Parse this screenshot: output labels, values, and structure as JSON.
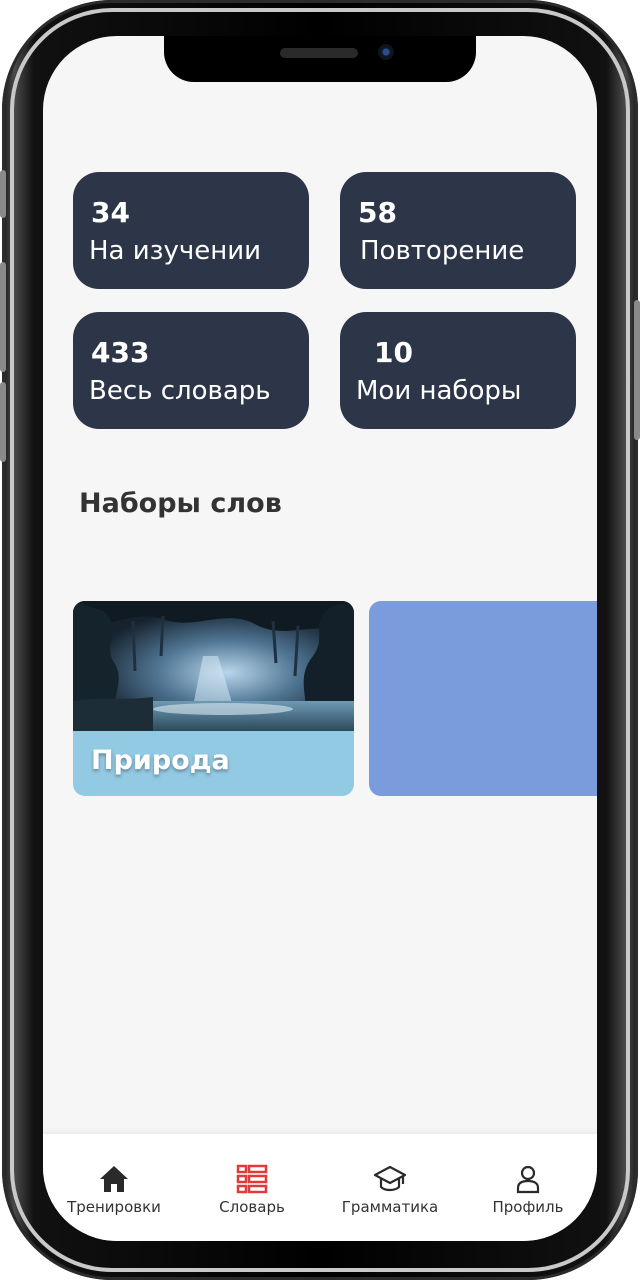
{
  "stats": [
    {
      "value": "34",
      "label": "На изучении"
    },
    {
      "value": "58",
      "label": "Повторение"
    },
    {
      "value": "433",
      "label": "Весь словарь"
    },
    {
      "value": "10",
      "label": "Мои наборы"
    }
  ],
  "sets_section": {
    "title": "Наборы слов"
  },
  "sets": [
    {
      "label": "Природа",
      "color": "#92c9e3"
    },
    {
      "label": "",
      "color": "#7b9cdc"
    }
  ],
  "tabbar": {
    "items": [
      {
        "label": "Тренировки",
        "icon": "home-icon"
      },
      {
        "label": "Словарь",
        "icon": "list-icon",
        "active": true
      },
      {
        "label": "Грамматика",
        "icon": "graduation-cap-icon"
      },
      {
        "label": "Профиль",
        "icon": "user-icon"
      }
    ]
  },
  "colors": {
    "card_bg": "#2d3648",
    "active_tab": "#e03a3a",
    "screen_bg": "#f6f6f7"
  }
}
